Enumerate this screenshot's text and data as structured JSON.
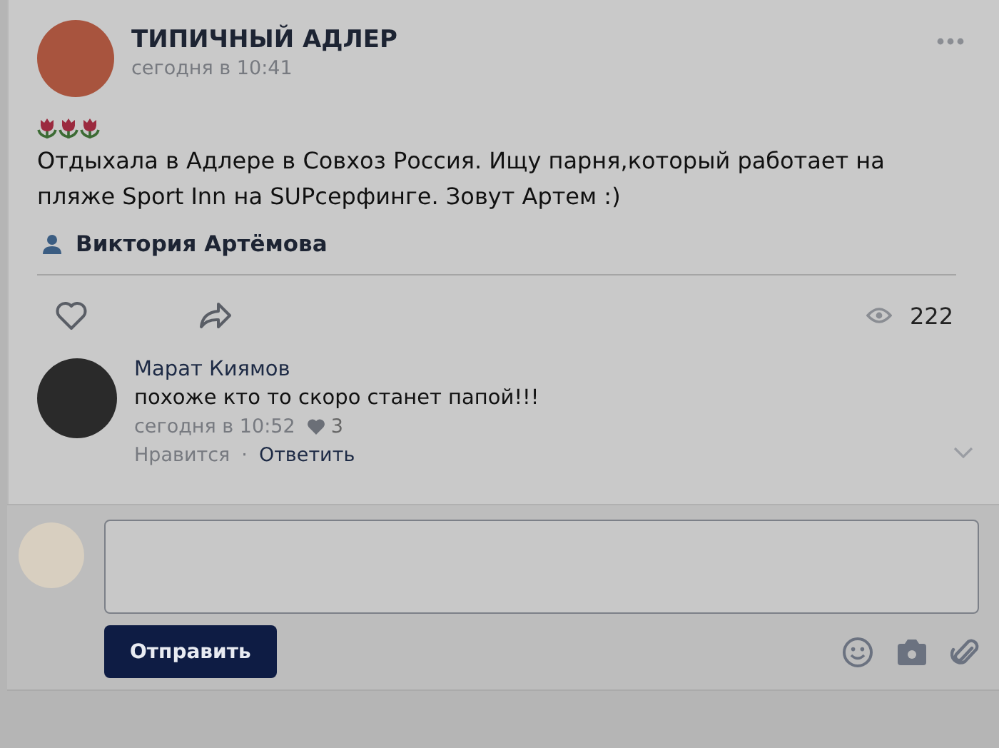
{
  "post": {
    "author": "ТИПИЧНЫЙ АДЛЕР",
    "time": "сегодня в 10:41",
    "text": "Отдыхала в Адлере в Совхоз Россия. Ищу парня,который работает на пляже Sport Inn на SUPсерфинге. Зовут Артем :)",
    "signer": "Виктория Артёмова",
    "views": "222",
    "liked": false
  },
  "comments": [
    {
      "author": "Марат Киямов",
      "text": "похоже кто то скоро станет папой!!!",
      "time": "сегодня в 10:52",
      "likes": "3",
      "like_label": "Нравится",
      "dot": "·",
      "reply_label": "Ответить"
    }
  ],
  "reply_form": {
    "button": "Отправить"
  }
}
